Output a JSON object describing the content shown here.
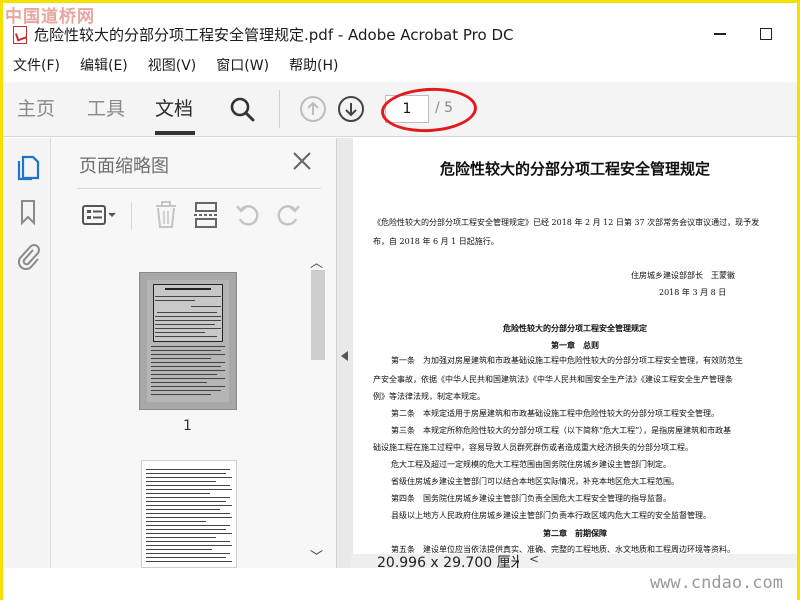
{
  "watermark": {
    "top": "中国道桥网",
    "bottom": "www.cndao.com"
  },
  "window": {
    "title": "危险性较大的分部分项工程安全管理规定.pdf - Adobe Acrobat Pro DC"
  },
  "menu": [
    "文件(F)",
    "编辑(E)",
    "视图(V)",
    "窗口(W)",
    "帮助(H)"
  ],
  "toolbar": {
    "tabs": {
      "home": "主页",
      "tools": "工具",
      "document": "文档"
    },
    "current_page": "1",
    "total_pages": "/ 5"
  },
  "panel": {
    "title": "页面缩略图",
    "thumb1_label": "1"
  },
  "status": {
    "page_size": "20.996 x 29.700 厘米"
  },
  "document": {
    "title": "危险性较大的分部分项工程安全管理规定",
    "lines": [
      "《危险性较大的分部分项工程安全管理规定》已经 2018 年 2 月 12 日第 37 次部常务会议审议通过，现予发",
      "布，自 2018 年 6 月 1 日起施行。",
      "住房城乡建设部部长　王蒙徽",
      "2018 年 3 月 8 日",
      "危险性较大的分部分项工程安全管理规定",
      "第一章　总则",
      "第一条　为加强对房屋建筑和市政基础设施工程中危险性较大的分部分项工程安全管理，有效防范生",
      "产安全事故，依据《中华人民共和国建筑法》《中华人民共和国安全生产法》《建设工程安全生产管理条",
      "例》等法律法规，制定本规定。",
      "第二条　本规定适用于房屋建筑和市政基础设施工程中危险性较大的分部分项工程安全管理。",
      "第三条　本规定所称危险性较大的分部分项工程（以下简称“危大工程”），是指房屋建筑和市政基",
      "础设施工程在施工过程中，容易导致人员群死群伤或者造成重大经济损失的分部分项工程。",
      "危大工程及超过一定规模的危大工程范围由国务院住房城乡建设主管部门制定。",
      "省级住房城乡建设主管部门可以结合本地区实际情况，补充本地区危大工程范围。",
      "第四条　国务院住房城乡建设主管部门负责全国危大工程安全管理的指导监督。",
      "县级以上地方人民政府住房城乡建设主管部门负责本行政区域内危大工程的安全监督管理。",
      "第二章　前期保障",
      "第五条　建设单位应当依法提供真实、准确、完整的工程地质、水文地质和工程周边环境等资料。"
    ]
  }
}
